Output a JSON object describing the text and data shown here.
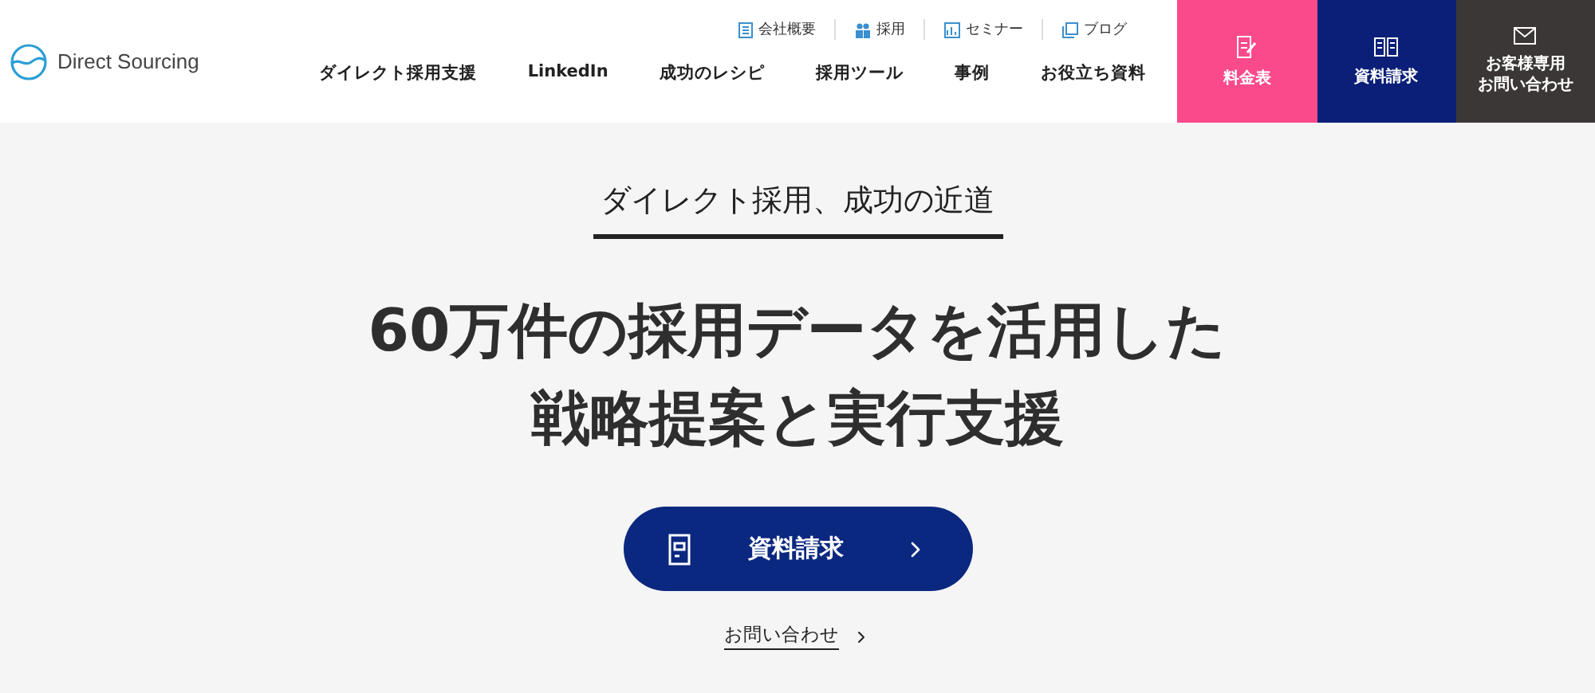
{
  "header": {
    "logo": "Direct Sourcing",
    "utility_links": [
      {
        "label": "会社概要",
        "kind": "company"
      },
      {
        "label": "採用",
        "kind": "recruit"
      },
      {
        "label": "セミナー",
        "kind": "seminar"
      },
      {
        "label": "ブログ",
        "kind": "blog"
      }
    ],
    "nav": [
      "ダイレクト採用支援",
      "LinkedIn",
      "成功のレシピ",
      "採用ツール",
      "事例",
      "お役立ち資料"
    ],
    "cta": [
      {
        "lines": [
          "料金表"
        ],
        "kind": "pricing",
        "color": "#fb4a8c"
      },
      {
        "lines": [
          "資料請求"
        ],
        "kind": "documents",
        "color": "#0b1f78"
      },
      {
        "lines": [
          "お客様専用",
          "お問い合わせ"
        ],
        "kind": "contact",
        "color": "#3b3736"
      }
    ]
  },
  "hero": {
    "tagline": "ダイレクト採用、成功の近道",
    "headline": [
      "60万件の採用データを活用した",
      "戦略提案と実行支援"
    ],
    "primary_button": "資料請求",
    "secondary_link": "お問い合わせ"
  }
}
